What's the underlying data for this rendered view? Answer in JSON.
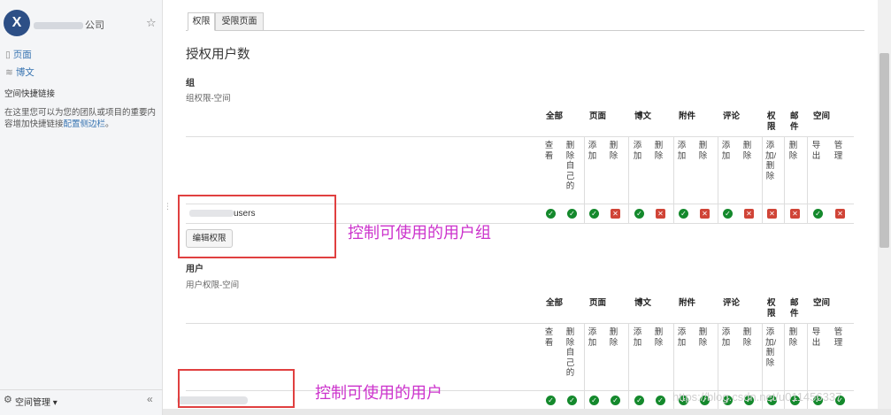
{
  "sidebar": {
    "logo_letter": "X",
    "space_name_suffix": "公司",
    "items": [
      {
        "label": "页面",
        "icon": "page-icon"
      },
      {
        "label": "博文",
        "icon": "rss-icon"
      }
    ],
    "quicklinks_heading": "空间快捷链接",
    "quicklinks_desc": "在这里您可以为您的团队或项目的重要内容增加快捷链接",
    "quicklinks_link": "配置侧边栏",
    "quicklinks_end": "。",
    "footer_label": "空间管理 ▾",
    "collapse": "«"
  },
  "tabs": [
    {
      "label": "权限",
      "active": true
    },
    {
      "label": "受限页面",
      "active": false
    }
  ],
  "main": {
    "title": "授权用户数",
    "group_section": {
      "heading": "组",
      "sub": "组权限-空间"
    },
    "user_section": {
      "heading": "用户",
      "sub": "用户权限-空间"
    },
    "group_row_name": "users",
    "edit_button": "编辑权限"
  },
  "columns": [
    "全部",
    "页面",
    "博文",
    "附件",
    "评论",
    "权限",
    "邮件",
    "空间"
  ],
  "perm_labels": [
    "查看",
    "删除自己的",
    "添加",
    "删除",
    "添加",
    "删除",
    "添加",
    "删除",
    "添加",
    "删除",
    "添加/删除",
    "删除",
    "导出",
    "管理"
  ],
  "group_values": [
    "ok",
    "ok",
    "ok",
    "no",
    "ok",
    "no",
    "ok",
    "no",
    "ok",
    "no",
    "no",
    "no",
    "ok",
    "no"
  ],
  "user_values": [
    "ok",
    "ok",
    "ok",
    "ok",
    "ok",
    "ok",
    "ok",
    "ok",
    "ok",
    "ok",
    "ok",
    "ok",
    "ok",
    "ok"
  ],
  "annotations": {
    "group_note": "控制可使用的用户组",
    "user_note": "控制可使用的用户"
  },
  "watermark": "https://blog.csdn.net/u011456337",
  "colors": {
    "ok": "#14892c",
    "no": "#d04437",
    "annotation": "#cc33cc",
    "box": "#e04040",
    "link": "#3572b0"
  }
}
